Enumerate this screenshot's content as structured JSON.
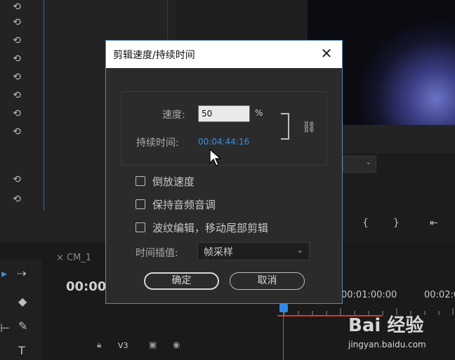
{
  "dialog": {
    "title": "剪辑速度/持续时间",
    "close_label": "✕",
    "speed_label": "速度:",
    "speed_value": "50",
    "speed_unit": "%",
    "duration_label": "持续时间:",
    "duration_value": "00:04:44:16",
    "checkboxes": [
      {
        "label": "倒放速度",
        "checked": false
      },
      {
        "label": "保持音频音调",
        "checked": false
      },
      {
        "label": "波纹编辑，移动尾部剪辑",
        "checked": false
      }
    ],
    "interpolation_label": "时间插值:",
    "interpolation_value": "帧采样",
    "ok_label": "确定",
    "cancel_label": "取消"
  },
  "background": {
    "sequence_tab": "CM_1",
    "sequence_timecode": "00:00",
    "timeline_tc_1": "00:01:00:00",
    "timeline_tc_2": "00:02:0",
    "track_label": "V3",
    "watermark": "Bai 经验",
    "watermark_url": "jingyan.baidu.com"
  },
  "colors": {
    "accent_blue": "#3d8fd8",
    "playhead_blue": "#2f8ae8",
    "work_area_red": "#d23c2a"
  }
}
